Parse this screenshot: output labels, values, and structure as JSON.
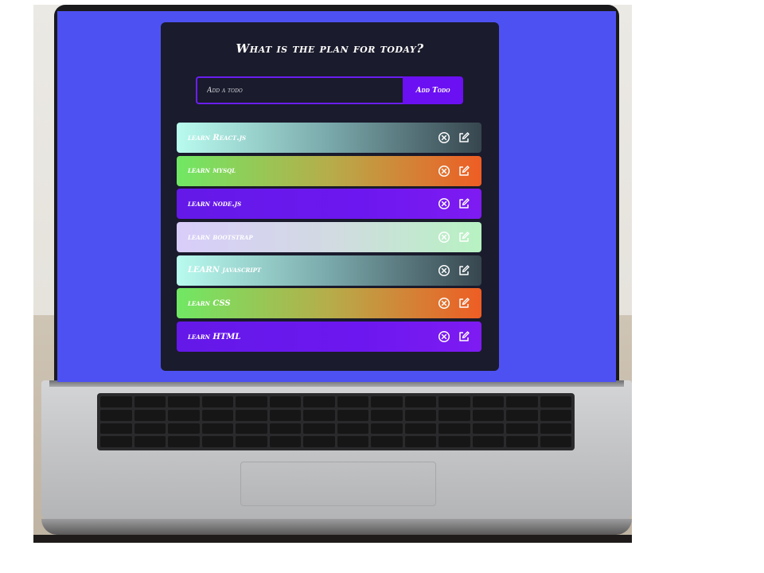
{
  "app": {
    "title": "What is the plan for today?",
    "input": {
      "placeholder": "Add a todo",
      "value": ""
    },
    "add_button_label": "Add Todo"
  },
  "todos": [
    {
      "text": "learn React.js",
      "gradient": "teal"
    },
    {
      "text": "learn mysql",
      "gradient": "green-orange"
    },
    {
      "text": "learn node.js",
      "gradient": "purple"
    },
    {
      "text": "learn bootstrap",
      "gradient": "lavender-mint"
    },
    {
      "text": "LEARN javascript",
      "gradient": "teal"
    },
    {
      "text": "learn CSS",
      "gradient": "green-orange"
    },
    {
      "text": "learn HTML",
      "gradient": "purple"
    }
  ],
  "icons": {
    "delete": "close-circle-icon",
    "edit": "edit-icon"
  },
  "colors": {
    "screen_background": "#4e51f2",
    "app_background": "#1a1b2c",
    "accent": "#6b10f2"
  }
}
